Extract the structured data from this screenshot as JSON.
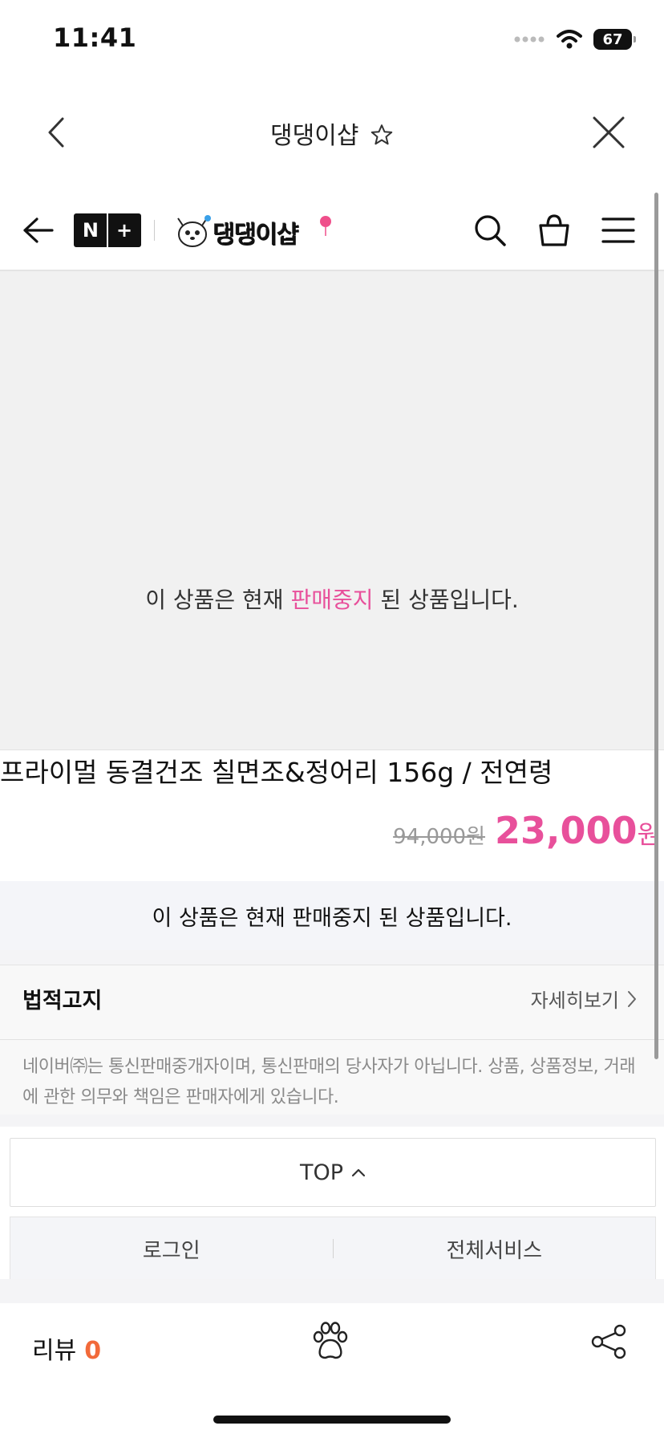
{
  "status_bar": {
    "time": "11:41",
    "battery": "67"
  },
  "title_bar": {
    "title": "댕댕이샵"
  },
  "header": {
    "badge_left": "N",
    "badge_right": "+",
    "logo_text": "댕댕이샵"
  },
  "product": {
    "image_message": {
      "prefix": "이 상품은 현재 ",
      "highlight": "판매중지",
      "suffix": " 된 상품입니다."
    },
    "title": "프라이멀 동결건조 칠면조&정어리 156g / 전연령",
    "original_price": "94,000원",
    "sale_price": "23,000",
    "sale_currency": "원"
  },
  "notice": {
    "text": "이 상품은 현재 판매중지 된 상품입니다."
  },
  "legal": {
    "title": "법적고지",
    "more": "자세히보기",
    "description": "네이버㈜는 통신판매중개자이며, 통신판매의 당사자가 아닙니다. 상품, 상품정보, 거래에 관한 의무와 책임은 판매자에게 있습니다."
  },
  "footer": {
    "top_button": "TOP",
    "login": "로그인",
    "all_services": "전체서비스"
  },
  "bottom_bar": {
    "review_label": "리뷰",
    "review_count": "0"
  },
  "colors": {
    "accent_pink": "#e8509b",
    "review_orange": "#f26a3a"
  }
}
